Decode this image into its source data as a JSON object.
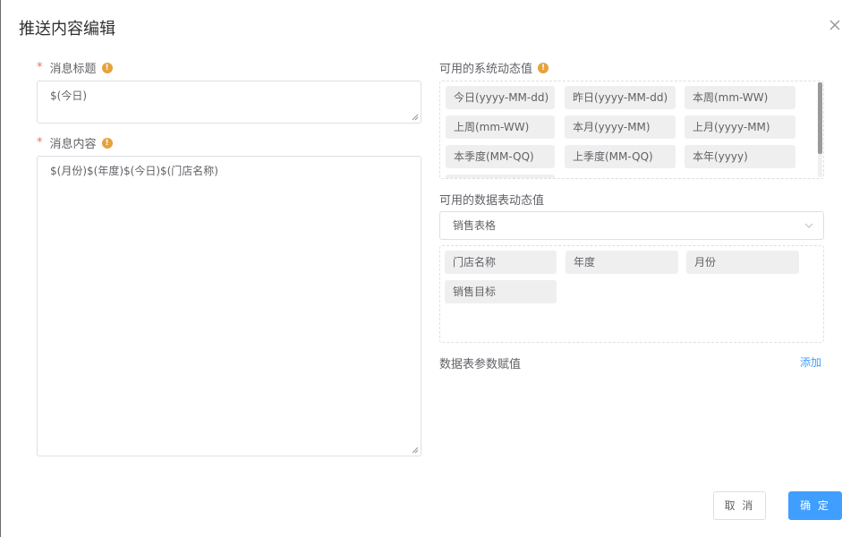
{
  "dialog": {
    "title": "推送内容编辑"
  },
  "form": {
    "required_mark": "*",
    "title_label": "消息标题",
    "title_value": "$(今日)",
    "content_label": "消息内容",
    "content_value": "$(月份)$(年度)$(今日)$(门店名称)"
  },
  "system_vars": {
    "label": "可用的系统动态值",
    "items": [
      "今日(yyyy-MM-dd)",
      "昨日(yyyy-MM-dd)",
      "本周(mm-WW)",
      "上周(mm-WW)",
      "本月(yyyy-MM)",
      "上月(yyyy-MM)",
      "本季度(MM-QQ)",
      "上季度(MM-QQ)",
      "本年(yyyy)"
    ]
  },
  "table_vars": {
    "label": "可用的数据表动态值",
    "selected_table": "销售表格",
    "items": [
      "门店名称",
      "年度",
      "月份",
      "销售目标"
    ]
  },
  "params": {
    "label": "数据表参数赋值",
    "add_label": "添加"
  },
  "footer": {
    "cancel_label": "取 消",
    "ok_label": "确 定"
  },
  "icons": {
    "warning": "exclamation-circle-icon",
    "close": "close-icon",
    "dropdown": "chevron-down-icon"
  },
  "colors": {
    "primary": "#409eff",
    "required": "#f56c6c",
    "warning": "#e6a23c",
    "tag_bg": "#efefef"
  }
}
